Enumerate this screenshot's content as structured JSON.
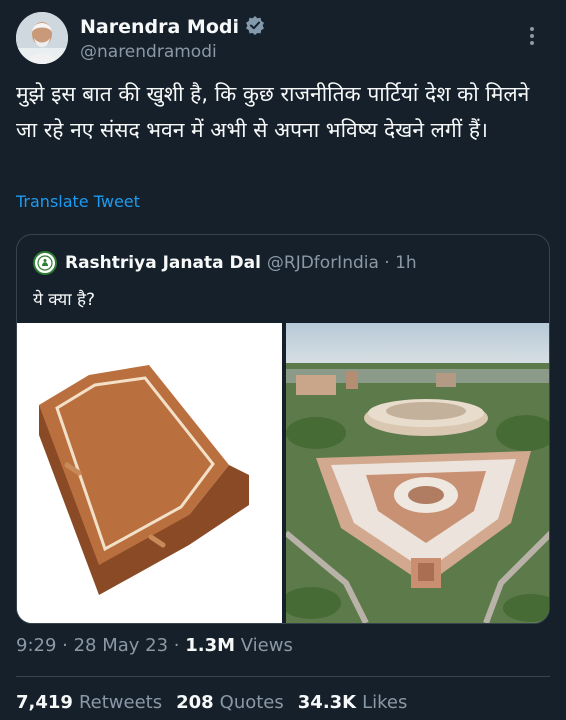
{
  "author": {
    "display_name": "Narendra Modi",
    "handle": "@narendramodi",
    "verified_icon": "verified-badge-icon"
  },
  "tweet": {
    "text": "मुझे इस बात की खुशी है, कि कुछ राजनीतिक पार्टियां देश को मिलने जा रहे नए संसद भवन में अभी से अपना भविष्य देखने लगीं हैं।",
    "translate_label": "Translate Tweet"
  },
  "quoted": {
    "display_name": "Rashtriya Janata Dal",
    "meta": "@RJDforIndia · 1h",
    "text": "ये क्या है?"
  },
  "meta": {
    "time": "9:29 · 28 May 23 · ",
    "views_count": "1.3M",
    "views_label": " Views"
  },
  "stats": {
    "retweets_count": "7,419",
    "retweets_label": "Retweets",
    "quotes_count": "208",
    "quotes_label": "Quotes",
    "likes_count": "34.3K",
    "likes_label": "Likes"
  },
  "colors": {
    "background": "#15202b",
    "link": "#1d9bf0",
    "muted": "#8b98a5",
    "border": "#38444d"
  }
}
